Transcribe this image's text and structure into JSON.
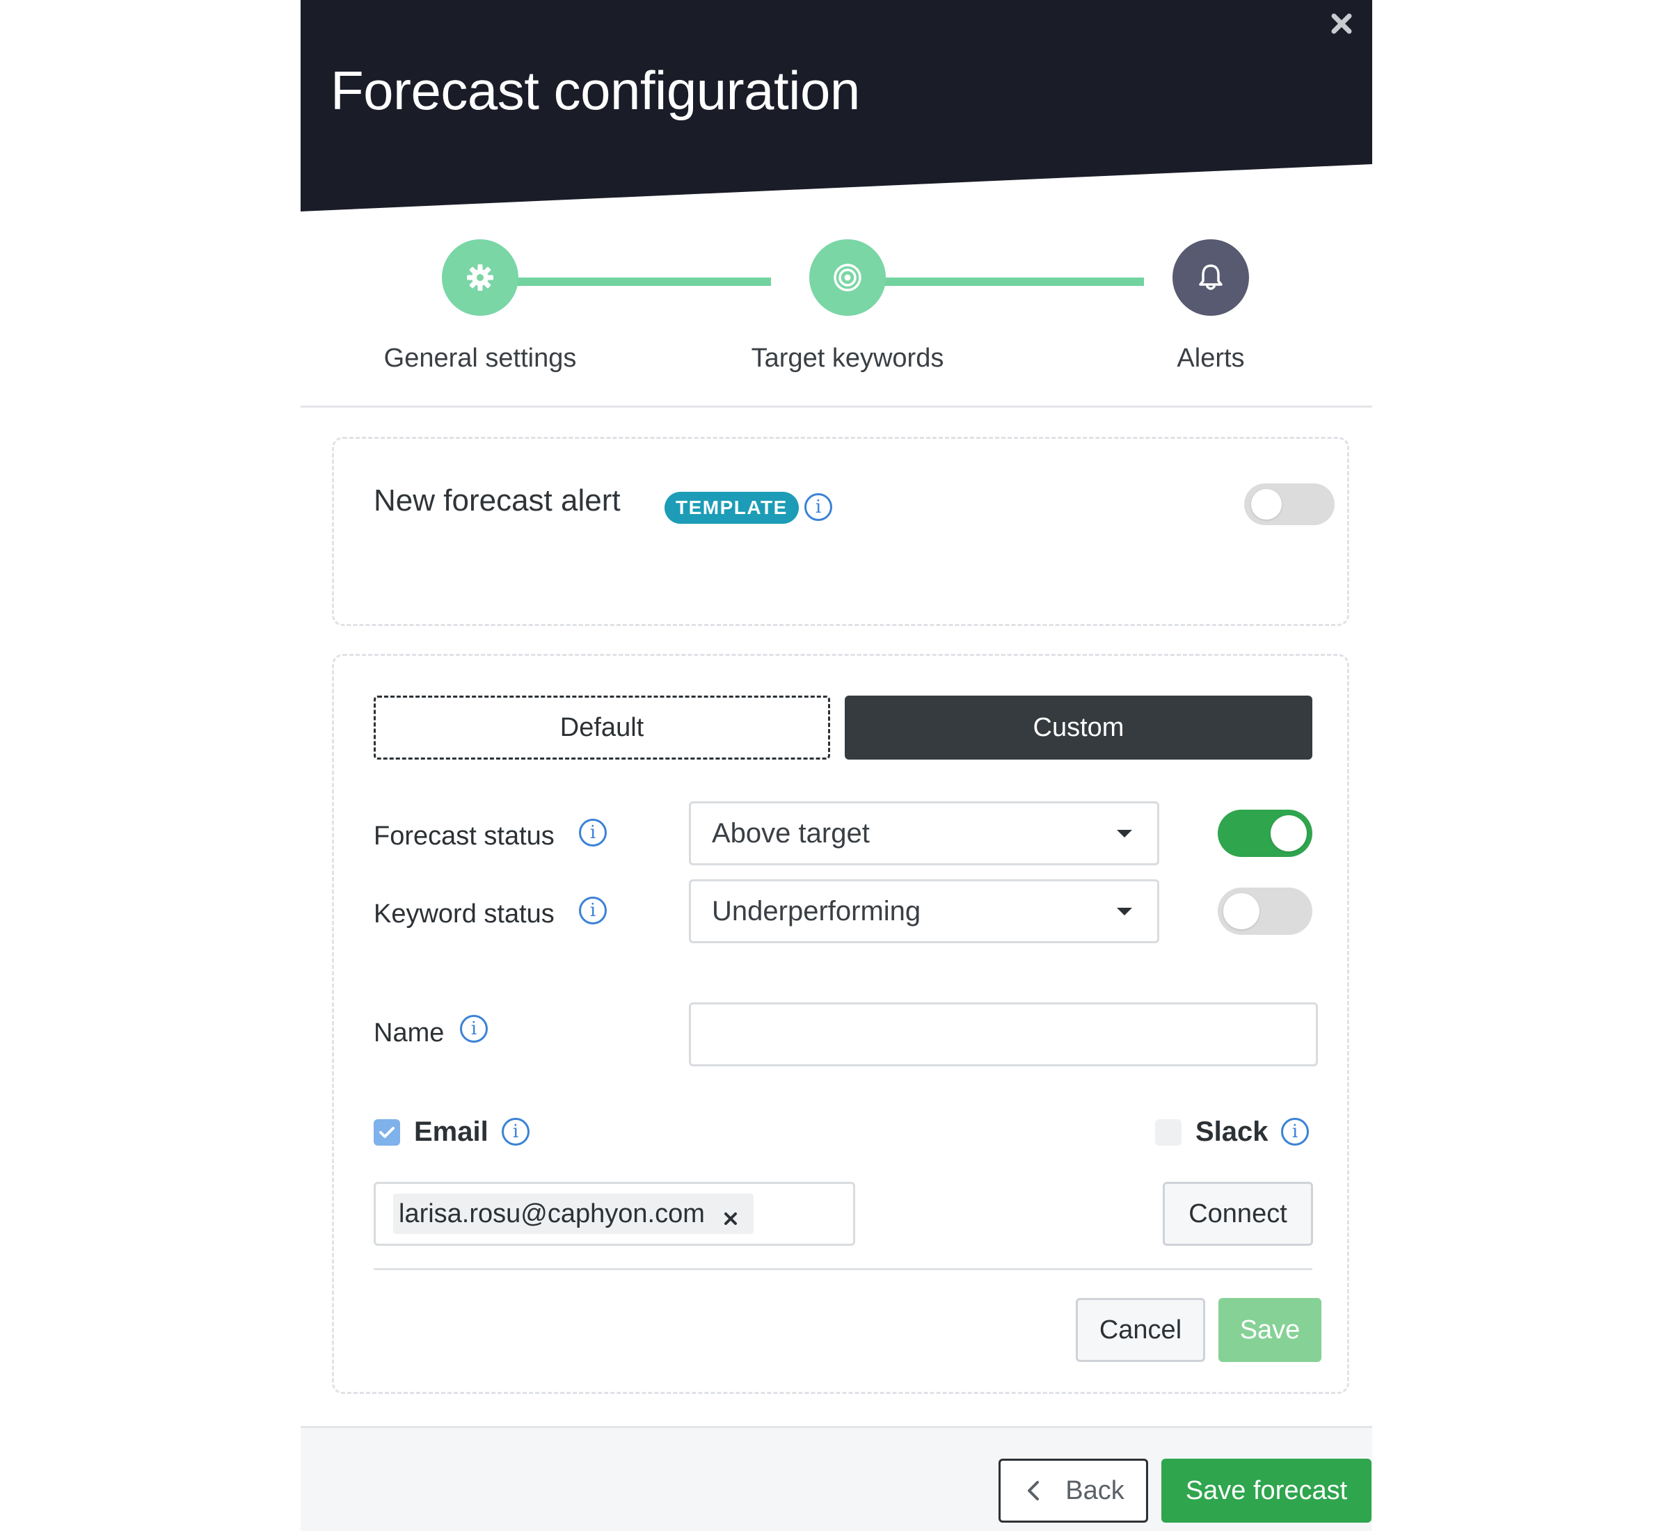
{
  "header": {
    "title": "Forecast configuration"
  },
  "steps": [
    {
      "label": "General settings",
      "icon": "gear-icon",
      "state": "done"
    },
    {
      "label": "Target keywords",
      "icon": "target-icon",
      "state": "done"
    },
    {
      "label": "Alerts",
      "icon": "bell-icon",
      "state": "current"
    }
  ],
  "alert_card": {
    "title": "New forecast alert",
    "badge": "TEMPLATE",
    "enabled": false
  },
  "config_card": {
    "tabs": {
      "default_label": "Default",
      "custom_label": "Custom",
      "selected": "Custom"
    },
    "forecast_status": {
      "label": "Forecast status",
      "value": "Above target",
      "enabled": true
    },
    "keyword_status": {
      "label": "Keyword status",
      "value": "Underperforming",
      "enabled": false
    },
    "name": {
      "label": "Name",
      "value": ""
    },
    "email": {
      "label": "Email",
      "checked": true,
      "recipients": [
        "larisa.rosu@caphyon.com"
      ]
    },
    "slack": {
      "label": "Slack",
      "checked": false,
      "connect_label": "Connect"
    },
    "cancel_label": "Cancel",
    "save_label": "Save"
  },
  "footer": {
    "back_label": "Back",
    "save_forecast_label": "Save forecast"
  },
  "colors": {
    "header_bg": "#1a1c28",
    "step_done": "#7ad6a5",
    "step_current": "#575a70",
    "badge": "#1c9cb6",
    "toggle_on": "#2fa54e",
    "primary_green": "#2fa54e",
    "info_blue": "#3b82d6"
  }
}
